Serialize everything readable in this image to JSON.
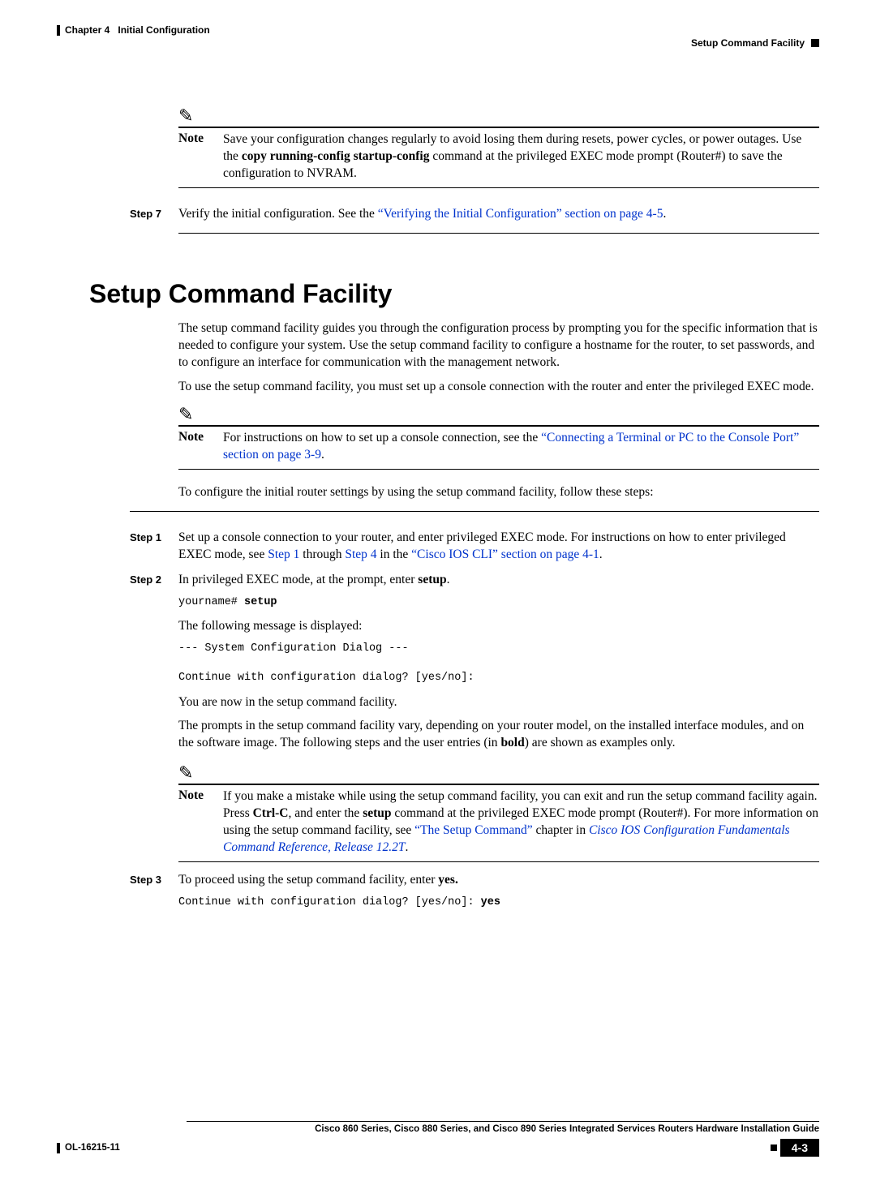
{
  "header": {
    "chapter_label": "Chapter 4",
    "chapter_title": "Initial Configuration",
    "section_right": "Setup Command Facility"
  },
  "note1": {
    "label": "Note",
    "text_1": "Save your configuration changes regularly to avoid losing them during resets, power cycles, or power outages. Use the ",
    "bold_cmd": "copy running-config startup-config",
    "text_2": " command at the privileged EXEC mode prompt (Router#) to save the configuration to NVRAM."
  },
  "step7": {
    "label": "Step 7",
    "text_1": "Verify the initial configuration. See the ",
    "link": "“Verifying the Initial Configuration” section on page 4-5",
    "text_2": "."
  },
  "section_title": "Setup Command Facility",
  "intro": {
    "p1": "The setup command facility guides you through the configuration process by prompting you for the specific information that is needed to configure your system. Use the setup command facility to configure a hostname for the router, to set passwords, and to configure an interface for communication with the management network.",
    "p2": "To use the setup command facility, you must set up a console connection with the router and enter the privileged EXEC mode."
  },
  "note2": {
    "label": "Note",
    "text_1": "For instructions on how to set up a console connection, see the ",
    "link": "“Connecting a Terminal or PC to the Console Port” section on page 3-9",
    "text_2": "."
  },
  "config_intro": "To configure the initial router settings by using the setup command facility, follow these steps:",
  "step1": {
    "label": "Step 1",
    "text_1": "Set up a console connection to your router, and enter privileged EXEC mode. For instructions on how to enter privileged EXEC mode, see ",
    "link_a": "Step 1",
    "text_2": " through ",
    "link_b": "Step 4",
    "text_3": " in the ",
    "link_c": "“Cisco IOS CLI” section on page 4-1",
    "text_4": "."
  },
  "step2": {
    "label": "Step 2",
    "text_1": "In privileged EXEC mode, at the prompt, enter ",
    "bold_setup": "setup",
    "text_2": ".",
    "code_1a": "yourname# ",
    "code_1b": "setup",
    "p2": "The following message is displayed:",
    "code_2": "--- System Configuration Dialog ---\n\nContinue with configuration dialog? [yes/no]:",
    "p3": "You are now in the setup command facility.",
    "p4_1": "The prompts in the setup command facility vary, depending on your router model, on the installed interface modules, and on the software image. The following steps and the user entries (in ",
    "p4_bold": "bold",
    "p4_2": ") are shown as examples only."
  },
  "note3": {
    "label": "Note",
    "text_1": "If you make a mistake while using the setup command facility, you can exit and run the setup command facility again. Press ",
    "bold_ctrlc": "Ctrl-C",
    "text_2": ", and enter the ",
    "bold_setup": "setup",
    "text_3": " command at the privileged EXEC mode prompt (Router#). For more information on using the setup command facility, see ",
    "link_a": "“The Setup Command”",
    "text_4": " chapter in ",
    "link_b": "Cisco IOS Configuration Fundamentals Command Reference, Release 12.2T",
    "text_5": "."
  },
  "step3": {
    "label": "Step 3",
    "text_1": "To proceed using the setup command facility, enter ",
    "bold_yes": "yes.",
    "code_a": "Continue with configuration dialog? [yes/no]: ",
    "code_b": "yes"
  },
  "footer": {
    "guide_title": "Cisco 860 Series, Cisco 880 Series, and Cisco 890 Series Integrated Services Routers Hardware Installation Guide",
    "doc_id": "OL-16215-11",
    "page_num": "4-3"
  }
}
